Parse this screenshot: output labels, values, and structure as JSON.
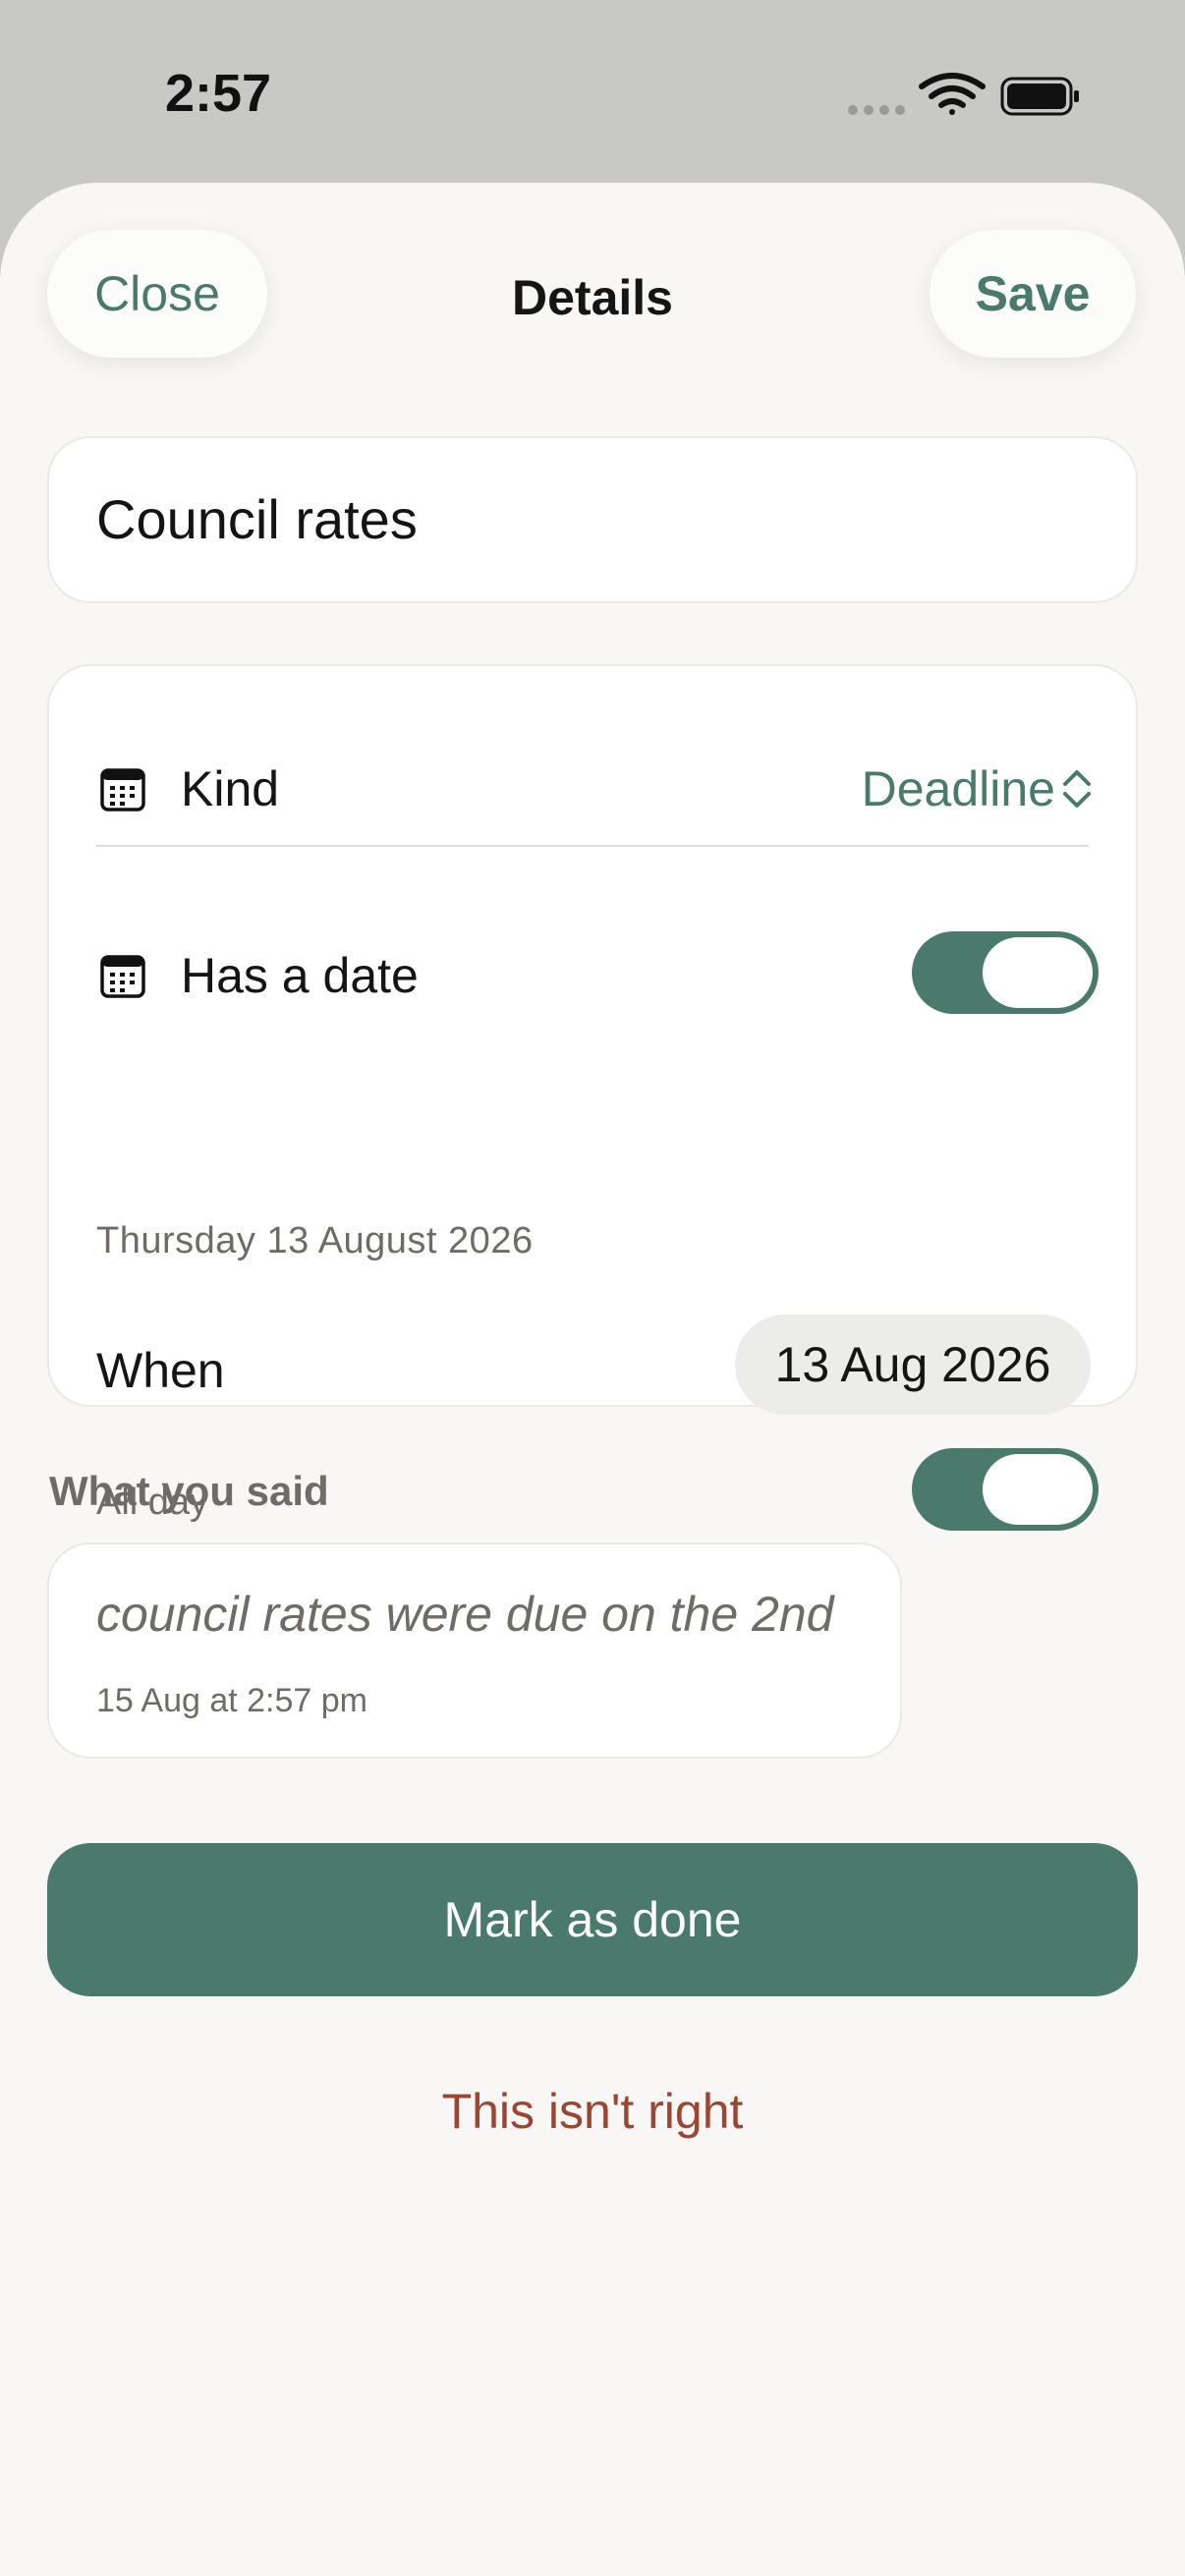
{
  "status_bar": {
    "time": "2:57"
  },
  "header": {
    "close_label": "Close",
    "title": "Details",
    "save_label": "Save"
  },
  "item": {
    "title": "Council rates"
  },
  "properties": {
    "kind_label": "Kind",
    "kind_value": "Deadline",
    "has_date_label": "Has a date",
    "has_date_on": true,
    "date_long": "Thursday 13 August 2026",
    "when_label": "When",
    "when_value": "13 Aug 2026",
    "all_day_label": "All day",
    "all_day_on": true
  },
  "said": {
    "section_label": "What you said",
    "text": "council rates were due on the 2nd",
    "timestamp": "15 Aug at 2:57 pm"
  },
  "actions": {
    "done_label": "Mark as done",
    "wrong_label": "This isn't right"
  },
  "colors": {
    "accent": "#4a7a6c",
    "danger": "#9a4632",
    "sheet_bg": "#f8f7f5"
  },
  "icons": {
    "kind": "calendar-icon",
    "has_date": "calendar-icon",
    "kind_picker": "chevron-up-down-icon"
  }
}
